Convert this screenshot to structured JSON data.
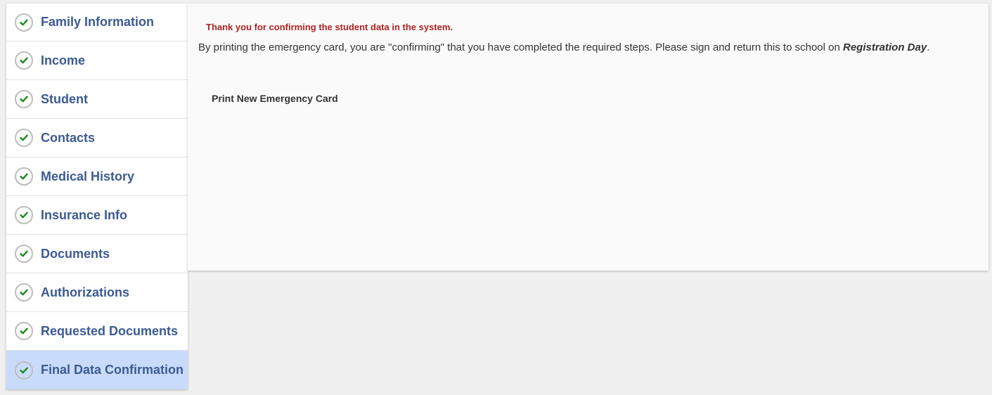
{
  "sidebar": {
    "items": [
      {
        "label": "Family Information",
        "icon": "check-icon",
        "status": "complete"
      },
      {
        "label": "Income",
        "icon": "check-icon",
        "status": "complete"
      },
      {
        "label": "Student",
        "icon": "check-icon",
        "status": "complete"
      },
      {
        "label": "Contacts",
        "icon": "check-icon",
        "status": "complete"
      },
      {
        "label": "Medical History",
        "icon": "check-icon",
        "status": "complete"
      },
      {
        "label": "Insurance Info",
        "icon": "check-icon",
        "status": "complete"
      },
      {
        "label": "Documents",
        "icon": "check-icon",
        "status": "complete"
      },
      {
        "label": "Authorizations",
        "icon": "check-icon",
        "status": "complete"
      },
      {
        "label": "Requested Documents",
        "icon": "check-icon",
        "status": "complete"
      },
      {
        "label": "Final Data Confirmation",
        "icon": "check-icon",
        "status": "complete",
        "active": true
      }
    ]
  },
  "main": {
    "thank_you": "Thank you for confirming the student data in the system.",
    "instructions_prefix": "By printing the emergency card, you are \"confirming\" that you have completed the required steps. Please sign and return this to school on ",
    "instructions_emphasis": "Registration Day",
    "instructions_suffix": ".",
    "print_button": "Print New Emergency Card"
  },
  "colors": {
    "nav_text": "#3c5a94",
    "active_item_bg": "#c9dbfa",
    "check_green": "#1a8a1a",
    "thank_you_red": "#b02222"
  }
}
